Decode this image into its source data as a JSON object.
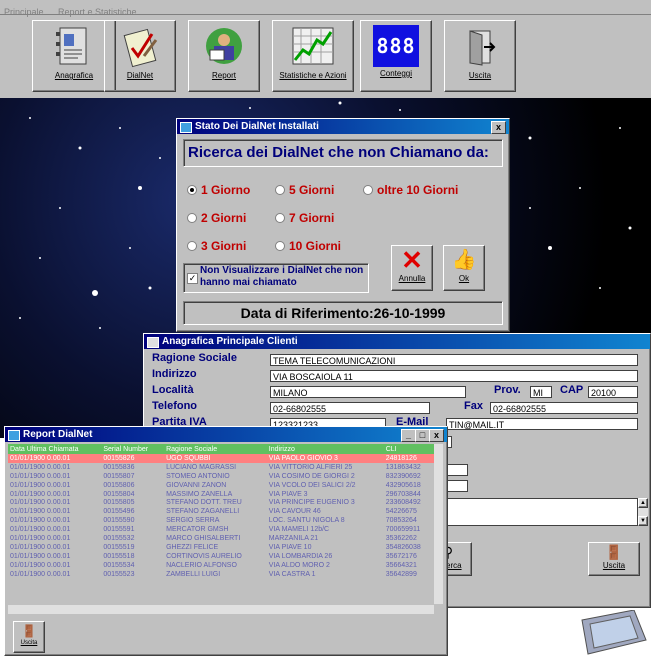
{
  "menu": {
    "items": [
      "Principale",
      "Report e Statistiche"
    ]
  },
  "toolbar": {
    "buttons": [
      {
        "label": "Anagrafica",
        "icon": "address-book-icon"
      },
      {
        "label": "DialNet",
        "icon": "clipboard-check-icon"
      },
      {
        "label": "Report",
        "icon": "person-reading-icon"
      },
      {
        "label": "Statistiche e Azioni",
        "icon": "stock-chart-icon"
      },
      {
        "label": "Conteggi",
        "icon": "digital-counter-icon"
      },
      {
        "label": "Uscita",
        "icon": "exit-door-icon"
      }
    ],
    "counter_display": "888"
  },
  "stato_dialog": {
    "title": "Stato Dei DialNet Installati",
    "close": "x",
    "heading": "Ricerca dei DialNet che non Chiamano da:",
    "options": [
      "1 Giorno",
      "5 Giorni",
      "oltre 10 Giorni",
      "2 Giorni",
      "7 Giorni",
      "3 Giorni",
      "10 Giorni"
    ],
    "selected": "1 Giorno",
    "checkbox_label": "Non Visualizzare i DialNet che non hanno mai chiamato",
    "checkbox_checked": true,
    "cancel_label": "Annulla",
    "ok_label": "Ok",
    "date_label": "Data di Riferimento:26-10-1999"
  },
  "anagrafica_window": {
    "title": "Anagrafica Principale Clienti",
    "fields": {
      "ragione_sociale_label": "Ragione Sociale",
      "ragione_sociale": "TEMA TELECOMUNICAZIONI",
      "indirizzo_label": "Indirizzo",
      "indirizzo": "VIA BOSCAIOLA 11",
      "localita_label": "Località",
      "localita": "MILANO",
      "prov_label": "Prov.",
      "prov": "MI",
      "cap_label": "CAP",
      "cap": "20100",
      "telefono_label": "Telefono",
      "telefono": "02-66802555",
      "fax_label": "Fax",
      "fax": "02-66802555",
      "partita_iva_label": "Partita IVA",
      "partita_iva": "123321233",
      "email_label": "E-Mail",
      "email": "TIN@MAIL.IT"
    },
    "search_button": "Ricerca",
    "exit_button": "Uscita"
  },
  "report_window": {
    "title": "Report DialNet",
    "columns": [
      "Data Ultima Chiamata",
      "Serial Number",
      "Ragione Sociale",
      "Indirizzo",
      "CLI"
    ],
    "rows": [
      [
        "01/01/1900 0.00.01",
        "00155826",
        "UGO SQUBBI",
        "VIA PAOLO GIOVIO 3",
        "24818126"
      ],
      [
        "01/01/1900 0.00.01",
        "00155836",
        "LUCIANO MAGRASSI",
        "VIA VITTORIO ALFIERI 25",
        "131863432"
      ],
      [
        "01/01/1900 0.00.01",
        "00155807",
        "STOMEO ANTONIO",
        "VIA COSIMO DE GIORGI 2",
        "832390692"
      ],
      [
        "01/01/1900 0.00.01",
        "00155806",
        "GIOVANNI ZANON",
        "VIA VCOLO DEI SALICI 2/2",
        "432905618"
      ],
      [
        "01/01/1900 0.00.01",
        "00155804",
        "MASSIMO ZANELLA",
        "VIA PIAVE 3",
        "296703844"
      ],
      [
        "01/01/1900 0.00.01",
        "00155805",
        "STEFANO DOTT. TREU",
        "VIA PRINCIPE EUGENIO 3",
        "233608492"
      ],
      [
        "01/01/1900 0.00.01",
        "00155496",
        "STEFANO ZAGANELLI",
        "VIA CAVOUR 46",
        "54226675"
      ],
      [
        "01/01/1900 0.00.01",
        "00155590",
        "SERGIO SERRA",
        "LOC. SANTU NIGOLA 8",
        "70853264"
      ],
      [
        "01/01/1900 0.00.01",
        "00155591",
        "MERCATOR GMSH",
        "VIA MAMELI 12b/C",
        "700659911"
      ],
      [
        "01/01/1900 0.00.01",
        "00155532",
        "MARCO GHISALBERTI",
        "MARZANILA 21",
        "35362262"
      ],
      [
        "01/01/1900 0.00.01",
        "00155519",
        "GHEZZI FELICE",
        "VIA PIAVE 10",
        "354826038"
      ],
      [
        "01/01/1900 0.00.01",
        "00155518",
        "CORTINOVIS AURELIO",
        "VIA LOMBARDIA 26",
        "35672176"
      ],
      [
        "01/01/1900 0.00.01",
        "00155534",
        "NACLERIO ALFONSO",
        "VIA ALDO MORO 2",
        "35664321"
      ],
      [
        "01/01/1900 0.00.01",
        "00155523",
        "ZAMBELLI LUIGI",
        "VIA CASTRA 1",
        "35642899"
      ]
    ],
    "exit_label": "Uscita"
  },
  "colors": {
    "title_blue": "#00007b",
    "label_blue": "#00007b",
    "radio_red": "#c00000",
    "highlight_row": "#ff8080",
    "header_green": "#60c060"
  }
}
